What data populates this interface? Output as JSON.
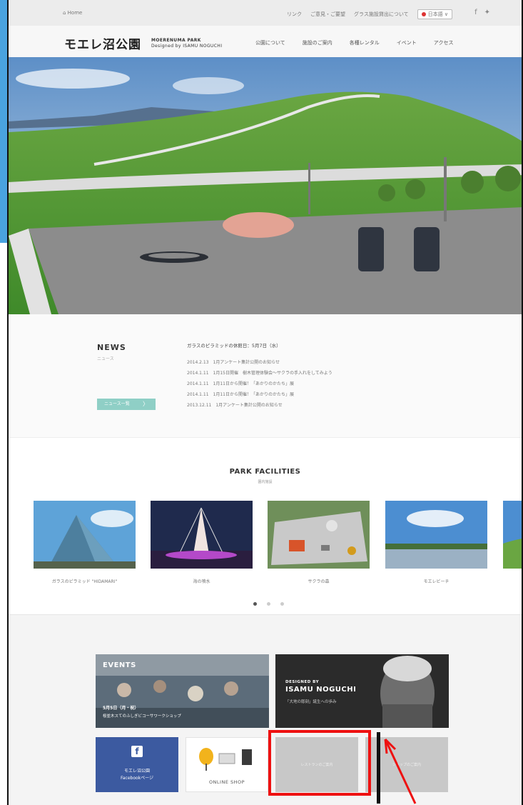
{
  "topbar": {
    "home": "⌂ Home",
    "links": [
      "リンク",
      "ご意見・ご要望",
      "グラス施設貸出について"
    ],
    "lang": "日本語 ∨",
    "social_fb": "f",
    "social_tw": "✦"
  },
  "header": {
    "logo_jp": "モエレ沼公園",
    "logo_en_1": "MOERENUMA PARK",
    "logo_en_2": "Designed by ISAMU NOGUCHI",
    "nav": [
      "公園について",
      "施設のご案内",
      "各種レンタル",
      "イベント",
      "アクセス"
    ]
  },
  "news": {
    "title": "NEWS",
    "subtitle": "ニュース",
    "headline": "ガラスのピラミッドの休館日：5月7日（水）",
    "items": [
      "2014.2.13　1月アンケート集計公開のお知らせ",
      "2014.1.11　1月15日開催　樹木管理体験会〜サクラの手入れをしてみよう",
      "2014.1.11　1月11日から開催！「あかりのかたち」展",
      "2014.1.11　1月11日から開催！「あかりのかたち」展",
      "2013.12.11　1月アンケート集計公開のお知らせ"
    ],
    "button": "ニュース一覧",
    "button_arrow": "〉"
  },
  "facilities": {
    "title": "PARK FACILITIES",
    "subtitle": "園内施設",
    "cards": [
      {
        "label": "ガラスのピラミッド \"HIDAMARI\""
      },
      {
        "label": "海の噴水"
      },
      {
        "label": "サクラの森"
      },
      {
        "label": "モエレビーチ"
      },
      {
        "label": ""
      }
    ]
  },
  "bottom": {
    "events_title": "EVENTS",
    "events_date": "5月5日（月・祝）",
    "events_desc": "桜並木スてのふしぎビコーサワークショップ",
    "noguchi_by": "DESIGNED BY",
    "noguchi_name": "ISAMU NOGUCHI",
    "noguchi_quote": "「大地の彫刻」誕生への歩み",
    "fb_icon": "f",
    "fb_line1": "モエレ沼公園",
    "fb_line2": "Facebookページ",
    "shop_label": "ONLINE SHOP",
    "grey1_label": "レストランのご案内",
    "grey2_label": "ショップのご案内"
  },
  "colors": {
    "news_button": "#8fcfc6",
    "facebook": "#3c5aa0",
    "annotation": "#e11111"
  }
}
